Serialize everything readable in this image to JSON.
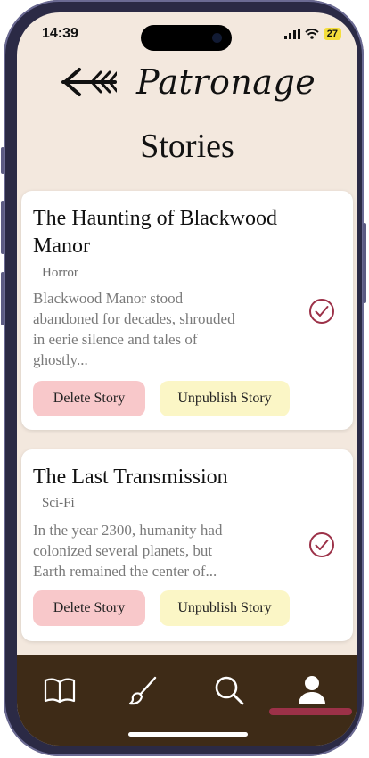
{
  "status": {
    "time": "14:39",
    "battery": "27"
  },
  "header": {
    "brand": "Patronage",
    "title": "Stories"
  },
  "stories": [
    {
      "title_line1": "The Haunting of Blackwood",
      "title_line2": "Manor",
      "genre": "Horror",
      "desc_lines": [
        "Blackwood Manor stood",
        "abandoned for decades, shrouded",
        "in eerie silence and tales of",
        "ghostly..."
      ],
      "delete_label": "Delete Story",
      "unpublish_label": "Unpublish Story"
    },
    {
      "title_line1": "The Last Transmission",
      "genre": "Sci-Fi",
      "desc_lines": [
        "In the year 2300, humanity had",
        "colonized several planets, but",
        "Earth remained the center of..."
      ],
      "delete_label": "Delete Story",
      "unpublish_label": "Unpublish Story"
    }
  ],
  "tabs": [
    {
      "icon": "book-icon"
    },
    {
      "icon": "brush-icon"
    },
    {
      "icon": "search-icon"
    },
    {
      "icon": "profile-icon",
      "active": true
    }
  ],
  "colors": {
    "background": "#f3e8de",
    "tabbar": "#3e2b17",
    "accent": "#9c3148",
    "delete_btn": "#f8c8ca",
    "unpublish_btn": "#fbf6c6"
  }
}
